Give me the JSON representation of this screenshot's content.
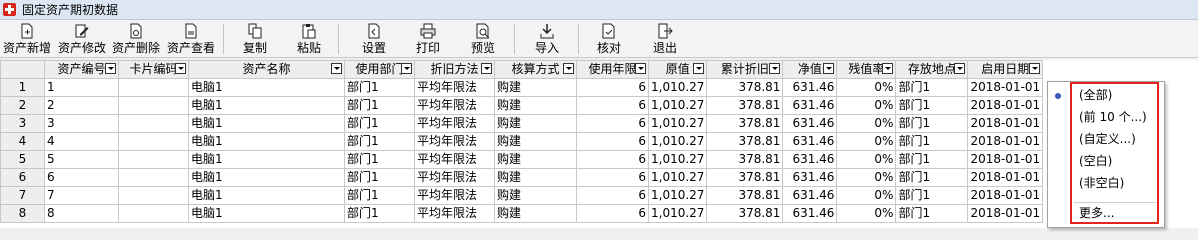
{
  "window": {
    "title": "固定资产期初数据"
  },
  "toolbar": {
    "add": "资产新增",
    "edit": "资产修改",
    "delete": "资产删除",
    "view": "资产查看",
    "copy": "复制",
    "paste": "粘贴",
    "settings": "设置",
    "print": "打印",
    "preview": "预览",
    "import": "导入",
    "verify": "核对",
    "exit": "退出"
  },
  "table": {
    "headers": {
      "asset_no": "资产编号",
      "card_no": "卡片编码",
      "asset_name": "资产名称",
      "dept": "使用部门",
      "method": "折旧方法",
      "calc": "核算方式",
      "years": "使用年限",
      "orig": "原值",
      "accum": "累计折旧",
      "net": "净值",
      "residual": "残值率",
      "location": "存放地点",
      "start": "启用日期"
    },
    "rows": [
      {
        "idx": "1",
        "asset_no": "1",
        "card_no": "",
        "asset_name": "电脑1",
        "dept": "部门1",
        "method": "平均年限法",
        "calc": "购建",
        "years": "6",
        "orig": "1,010.27",
        "accum": "378.81",
        "net": "631.46",
        "residual": "0%",
        "location": "部门1",
        "start": "2018-01-01"
      },
      {
        "idx": "2",
        "asset_no": "2",
        "card_no": "",
        "asset_name": "电脑1",
        "dept": "部门1",
        "method": "平均年限法",
        "calc": "购建",
        "years": "6",
        "orig": "1,010.27",
        "accum": "378.81",
        "net": "631.46",
        "residual": "0%",
        "location": "部门1",
        "start": "2018-01-01"
      },
      {
        "idx": "3",
        "asset_no": "3",
        "card_no": "",
        "asset_name": "电脑1",
        "dept": "部门1",
        "method": "平均年限法",
        "calc": "购建",
        "years": "6",
        "orig": "1,010.27",
        "accum": "378.81",
        "net": "631.46",
        "residual": "0%",
        "location": "部门1",
        "start": "2018-01-01"
      },
      {
        "idx": "4",
        "asset_no": "4",
        "card_no": "",
        "asset_name": "电脑1",
        "dept": "部门1",
        "method": "平均年限法",
        "calc": "购建",
        "years": "6",
        "orig": "1,010.27",
        "accum": "378.81",
        "net": "631.46",
        "residual": "0%",
        "location": "部门1",
        "start": "2018-01-01"
      },
      {
        "idx": "5",
        "asset_no": "5",
        "card_no": "",
        "asset_name": "电脑1",
        "dept": "部门1",
        "method": "平均年限法",
        "calc": "购建",
        "years": "6",
        "orig": "1,010.27",
        "accum": "378.81",
        "net": "631.46",
        "residual": "0%",
        "location": "部门1",
        "start": "2018-01-01"
      },
      {
        "idx": "6",
        "asset_no": "6",
        "card_no": "",
        "asset_name": "电脑1",
        "dept": "部门1",
        "method": "平均年限法",
        "calc": "购建",
        "years": "6",
        "orig": "1,010.27",
        "accum": "378.81",
        "net": "631.46",
        "residual": "0%",
        "location": "部门1",
        "start": "2018-01-01"
      },
      {
        "idx": "7",
        "asset_no": "7",
        "card_no": "",
        "asset_name": "电脑1",
        "dept": "部门1",
        "method": "平均年限法",
        "calc": "购建",
        "years": "6",
        "orig": "1,010.27",
        "accum": "378.81",
        "net": "631.46",
        "residual": "0%",
        "location": "部门1",
        "start": "2018-01-01"
      },
      {
        "idx": "8",
        "asset_no": "8",
        "card_no": "",
        "asset_name": "电脑1",
        "dept": "部门1",
        "method": "平均年限法",
        "calc": "购建",
        "years": "6",
        "orig": "1,010.27",
        "accum": "378.81",
        "net": "631.46",
        "residual": "0%",
        "location": "部门1",
        "start": "2018-01-01"
      }
    ]
  },
  "filter_menu": {
    "all": "(全部)",
    "top10": "(前 10 个...)",
    "custom": "(自定义...)",
    "blank": "(空白)",
    "nonblank": "(非空白)",
    "more": "更多..."
  },
  "colors": {
    "titlebar": "#dde7f4",
    "highlight_box": "#e3231c",
    "bullet": "#3a58b8"
  }
}
